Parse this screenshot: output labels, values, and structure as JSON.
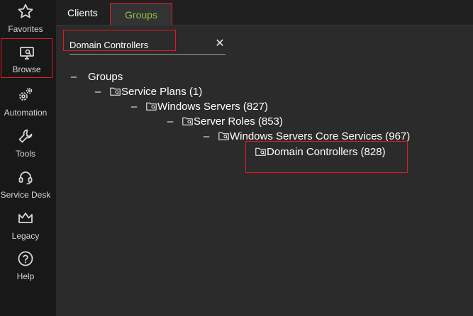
{
  "sidebar": {
    "items": [
      {
        "label": "Favorites",
        "icon": "star-icon"
      },
      {
        "label": "Browse",
        "icon": "monitor-search-icon"
      },
      {
        "label": "Automation",
        "icon": "gears-icon"
      },
      {
        "label": "Tools",
        "icon": "wrench-icon"
      },
      {
        "label": "Service Desk",
        "icon": "headset-icon"
      },
      {
        "label": "Legacy",
        "icon": "crown-icon"
      },
      {
        "label": "Help",
        "icon": "help-icon"
      }
    ]
  },
  "tabs": {
    "clients": "Clients",
    "groups": "Groups"
  },
  "search": {
    "value": "Domain Controllers",
    "clear_symbol": "✕"
  },
  "tree": {
    "toggle_symbol": "–",
    "root": "Groups",
    "level1": "Service Plans (1)",
    "level2": "Windows Servers (827)",
    "level3": "Server Roles (853)",
    "level4": "Windows Servers Core Services (967)",
    "level5": "Domain Controllers (828)"
  },
  "colors": {
    "accent_green": "#8bc34a",
    "highlight_red": "#e01b24",
    "sidebar_bg": "#181818",
    "main_bg": "#2b2b2b"
  }
}
